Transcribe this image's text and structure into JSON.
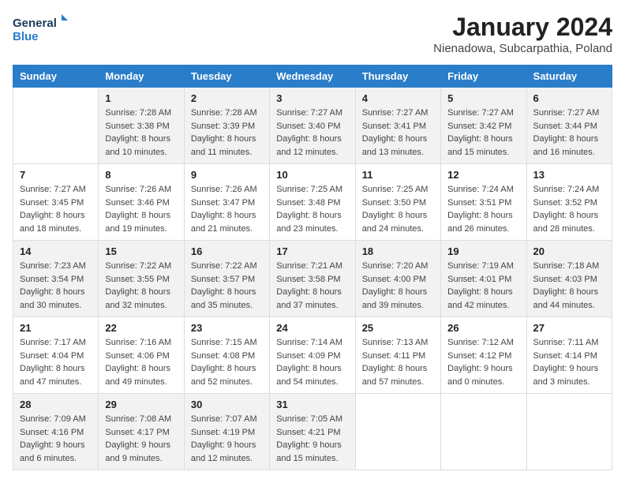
{
  "header": {
    "logo_general": "General",
    "logo_blue": "Blue",
    "title": "January 2024",
    "location": "Nienadowa, Subcarpathia, Poland"
  },
  "days_of_week": [
    "Sunday",
    "Monday",
    "Tuesday",
    "Wednesday",
    "Thursday",
    "Friday",
    "Saturday"
  ],
  "weeks": [
    [
      {
        "day": "",
        "sunrise": "",
        "sunset": "",
        "daylight": ""
      },
      {
        "day": "1",
        "sunrise": "Sunrise: 7:28 AM",
        "sunset": "Sunset: 3:38 PM",
        "daylight": "Daylight: 8 hours and 10 minutes."
      },
      {
        "day": "2",
        "sunrise": "Sunrise: 7:28 AM",
        "sunset": "Sunset: 3:39 PM",
        "daylight": "Daylight: 8 hours and 11 minutes."
      },
      {
        "day": "3",
        "sunrise": "Sunrise: 7:27 AM",
        "sunset": "Sunset: 3:40 PM",
        "daylight": "Daylight: 8 hours and 12 minutes."
      },
      {
        "day": "4",
        "sunrise": "Sunrise: 7:27 AM",
        "sunset": "Sunset: 3:41 PM",
        "daylight": "Daylight: 8 hours and 13 minutes."
      },
      {
        "day": "5",
        "sunrise": "Sunrise: 7:27 AM",
        "sunset": "Sunset: 3:42 PM",
        "daylight": "Daylight: 8 hours and 15 minutes."
      },
      {
        "day": "6",
        "sunrise": "Sunrise: 7:27 AM",
        "sunset": "Sunset: 3:44 PM",
        "daylight": "Daylight: 8 hours and 16 minutes."
      }
    ],
    [
      {
        "day": "7",
        "sunrise": "Sunrise: 7:27 AM",
        "sunset": "Sunset: 3:45 PM",
        "daylight": "Daylight: 8 hours and 18 minutes."
      },
      {
        "day": "8",
        "sunrise": "Sunrise: 7:26 AM",
        "sunset": "Sunset: 3:46 PM",
        "daylight": "Daylight: 8 hours and 19 minutes."
      },
      {
        "day": "9",
        "sunrise": "Sunrise: 7:26 AM",
        "sunset": "Sunset: 3:47 PM",
        "daylight": "Daylight: 8 hours and 21 minutes."
      },
      {
        "day": "10",
        "sunrise": "Sunrise: 7:25 AM",
        "sunset": "Sunset: 3:48 PM",
        "daylight": "Daylight: 8 hours and 23 minutes."
      },
      {
        "day": "11",
        "sunrise": "Sunrise: 7:25 AM",
        "sunset": "Sunset: 3:50 PM",
        "daylight": "Daylight: 8 hours and 24 minutes."
      },
      {
        "day": "12",
        "sunrise": "Sunrise: 7:24 AM",
        "sunset": "Sunset: 3:51 PM",
        "daylight": "Daylight: 8 hours and 26 minutes."
      },
      {
        "day": "13",
        "sunrise": "Sunrise: 7:24 AM",
        "sunset": "Sunset: 3:52 PM",
        "daylight": "Daylight: 8 hours and 28 minutes."
      }
    ],
    [
      {
        "day": "14",
        "sunrise": "Sunrise: 7:23 AM",
        "sunset": "Sunset: 3:54 PM",
        "daylight": "Daylight: 8 hours and 30 minutes."
      },
      {
        "day": "15",
        "sunrise": "Sunrise: 7:22 AM",
        "sunset": "Sunset: 3:55 PM",
        "daylight": "Daylight: 8 hours and 32 minutes."
      },
      {
        "day": "16",
        "sunrise": "Sunrise: 7:22 AM",
        "sunset": "Sunset: 3:57 PM",
        "daylight": "Daylight: 8 hours and 35 minutes."
      },
      {
        "day": "17",
        "sunrise": "Sunrise: 7:21 AM",
        "sunset": "Sunset: 3:58 PM",
        "daylight": "Daylight: 8 hours and 37 minutes."
      },
      {
        "day": "18",
        "sunrise": "Sunrise: 7:20 AM",
        "sunset": "Sunset: 4:00 PM",
        "daylight": "Daylight: 8 hours and 39 minutes."
      },
      {
        "day": "19",
        "sunrise": "Sunrise: 7:19 AM",
        "sunset": "Sunset: 4:01 PM",
        "daylight": "Daylight: 8 hours and 42 minutes."
      },
      {
        "day": "20",
        "sunrise": "Sunrise: 7:18 AM",
        "sunset": "Sunset: 4:03 PM",
        "daylight": "Daylight: 8 hours and 44 minutes."
      }
    ],
    [
      {
        "day": "21",
        "sunrise": "Sunrise: 7:17 AM",
        "sunset": "Sunset: 4:04 PM",
        "daylight": "Daylight: 8 hours and 47 minutes."
      },
      {
        "day": "22",
        "sunrise": "Sunrise: 7:16 AM",
        "sunset": "Sunset: 4:06 PM",
        "daylight": "Daylight: 8 hours and 49 minutes."
      },
      {
        "day": "23",
        "sunrise": "Sunrise: 7:15 AM",
        "sunset": "Sunset: 4:08 PM",
        "daylight": "Daylight: 8 hours and 52 minutes."
      },
      {
        "day": "24",
        "sunrise": "Sunrise: 7:14 AM",
        "sunset": "Sunset: 4:09 PM",
        "daylight": "Daylight: 8 hours and 54 minutes."
      },
      {
        "day": "25",
        "sunrise": "Sunrise: 7:13 AM",
        "sunset": "Sunset: 4:11 PM",
        "daylight": "Daylight: 8 hours and 57 minutes."
      },
      {
        "day": "26",
        "sunrise": "Sunrise: 7:12 AM",
        "sunset": "Sunset: 4:12 PM",
        "daylight": "Daylight: 9 hours and 0 minutes."
      },
      {
        "day": "27",
        "sunrise": "Sunrise: 7:11 AM",
        "sunset": "Sunset: 4:14 PM",
        "daylight": "Daylight: 9 hours and 3 minutes."
      }
    ],
    [
      {
        "day": "28",
        "sunrise": "Sunrise: 7:09 AM",
        "sunset": "Sunset: 4:16 PM",
        "daylight": "Daylight: 9 hours and 6 minutes."
      },
      {
        "day": "29",
        "sunrise": "Sunrise: 7:08 AM",
        "sunset": "Sunset: 4:17 PM",
        "daylight": "Daylight: 9 hours and 9 minutes."
      },
      {
        "day": "30",
        "sunrise": "Sunrise: 7:07 AM",
        "sunset": "Sunset: 4:19 PM",
        "daylight": "Daylight: 9 hours and 12 minutes."
      },
      {
        "day": "31",
        "sunrise": "Sunrise: 7:05 AM",
        "sunset": "Sunset: 4:21 PM",
        "daylight": "Daylight: 9 hours and 15 minutes."
      },
      {
        "day": "",
        "sunrise": "",
        "sunset": "",
        "daylight": ""
      },
      {
        "day": "",
        "sunrise": "",
        "sunset": "",
        "daylight": ""
      },
      {
        "day": "",
        "sunrise": "",
        "sunset": "",
        "daylight": ""
      }
    ]
  ]
}
